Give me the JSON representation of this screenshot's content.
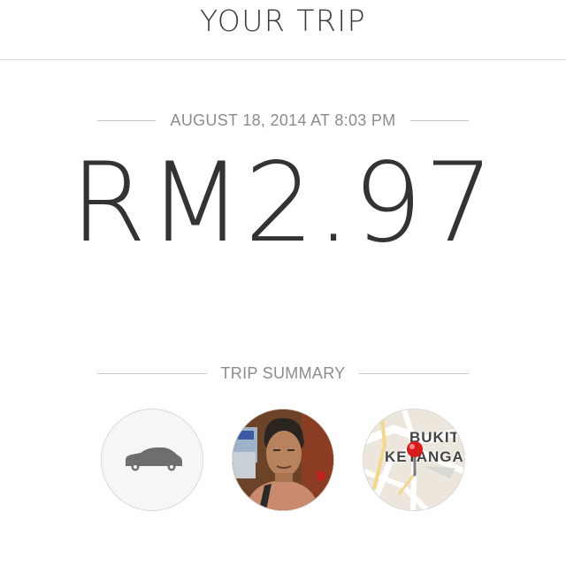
{
  "header": {
    "title": "YOUR TRIP"
  },
  "trip": {
    "datetime": "AUGUST 18, 2014 AT 8:03 PM",
    "fare": "RM2.97"
  },
  "summary": {
    "label": "TRIP SUMMARY",
    "items": [
      {
        "icon": "car-icon"
      },
      {
        "icon": "driver-photo"
      },
      {
        "icon": "map-pin-icon",
        "map_label_line1": "BUKIT",
        "map_label_line2": "KETANGA"
      }
    ]
  },
  "colors": {
    "text": "#333333",
    "muted": "#8c8c8c",
    "rule": "#c9c9c9",
    "pin": "#d81b1b"
  }
}
